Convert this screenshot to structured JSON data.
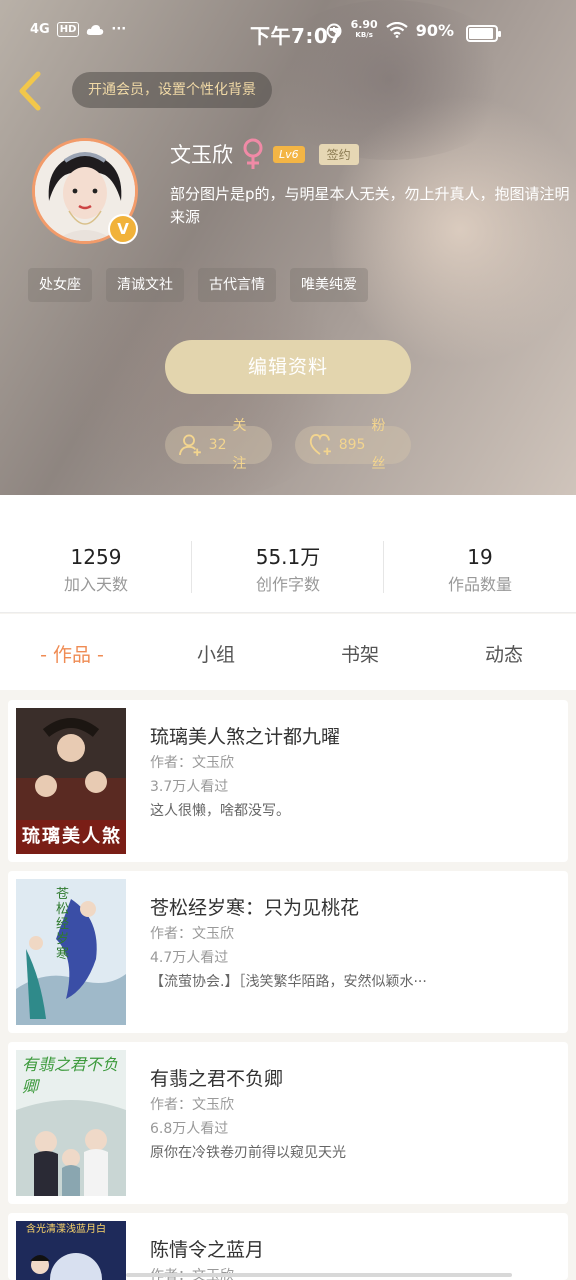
{
  "status_bar": {
    "network": "4G",
    "hd": "HD",
    "dots": "···",
    "time": "下午7:07",
    "speed": "6.90",
    "speed_unit": "KB/s",
    "battery": "90%"
  },
  "header": {
    "vip_text": "开通会员，设置个性化背景",
    "name": "文玉欣",
    "gender_icon": "♀",
    "level": "Lv6",
    "signed": "签约",
    "avatar_badge": "V",
    "bio": "部分图片是p的，与明星本人无关，勿上升真人，抱图请注明来源",
    "tags": [
      "处女座",
      "清诚文社",
      "古代言情",
      "唯美纯爱"
    ],
    "edit_button": "编辑资料",
    "following_count": "32",
    "following_label": "关注",
    "fans_count": "895",
    "fans_label": "粉丝"
  },
  "stats": [
    {
      "value": "1259",
      "label": "加入天数"
    },
    {
      "value": "55.1万",
      "label": "创作字数"
    },
    {
      "value": "19",
      "label": "作品数量"
    }
  ],
  "tabs": [
    "- 作品 -",
    "小组",
    "书架",
    "动态"
  ],
  "books": [
    {
      "title": "琉璃美人煞之计都九曜",
      "author": "作者：文玉欣",
      "views": "3.7万人看过",
      "desc": "这人很懒，啥都没写。",
      "cover_text": "琉璃美人煞"
    },
    {
      "title": "苍松经岁寒：只为见桃花",
      "author": "作者：文玉欣",
      "views": "4.7万人看过",
      "desc": "【流萤协会.】［浅笑繁华陌路，安然似颖水···",
      "cover_text": "苍松经岁寒"
    },
    {
      "title": "有翡之君不负卿",
      "author": "作者：文玉欣",
      "views": "6.8万人看过",
      "desc": "原你在冷铁卷刃前得以窥见天光",
      "cover_text": "有翡之君不负卿"
    },
    {
      "title": "陈情令之蓝月",
      "author": "作者：文玉欣",
      "views": "",
      "desc": "",
      "cover_text": "含光清渫浅蓝月白"
    }
  ],
  "colors": {
    "accent": "#ef8b53",
    "gold": "#e3d5ae",
    "level": "#f3b545"
  }
}
